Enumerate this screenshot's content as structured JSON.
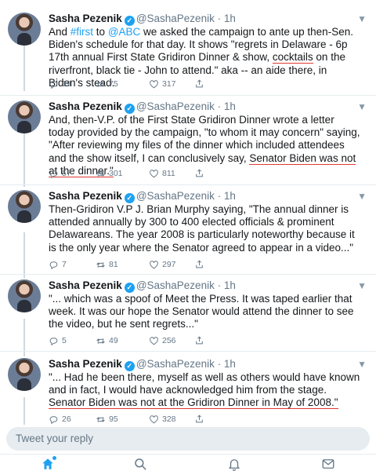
{
  "author": {
    "name": "Sasha Pezenik",
    "handle": "@SashaPezenik",
    "time": "· 1h"
  },
  "tweets": [
    {
      "t1": "And ",
      "t2": "#first",
      "t3": " to ",
      "t4": "@ABC",
      "t5": " we asked the campaign to ante up then-Sen. Biden's schedule for that day. It shows \"regrets in Delaware - 6p 17th annual First State Gridiron Dinner & show, ",
      "t6": "cocktails",
      "t7": " on the riverfront, black tie - John to attend.\" aka -- an aide there, in Biden's stead.",
      "reply_count": "19",
      "retweet_count": "75",
      "like_count": "317"
    },
    {
      "t1": "And, then-V.P. of the First State Gridiron Dinner wrote a letter today provided by the campaign, \"to whom it may concern\" saying, \"After reviewing my files of the dinner which included attendees and the show itself, I can conclusively say, ",
      "t2": "Senator Biden was not at the dinner.\"",
      "reply_count": "57",
      "retweet_count": "301",
      "like_count": "811"
    },
    {
      "t1": "Then-Gridiron V.P J. Brian Murphy saying, \"The annual dinner is attended annually by 300 to 400 elected officials & prominent Delawareans. The year 2008 is particularly noteworthy because it is the only year where the Senator agreed to appear in a video...\"",
      "reply_count": "7",
      "retweet_count": "81",
      "like_count": "297"
    },
    {
      "t1": "\"... which was a spoof of Meet the Press. It was taped earlier that week. It was our hope the Senator would attend the dinner to see the video, but he sent regrets...\"",
      "reply_count": "5",
      "retweet_count": "49",
      "like_count": "256"
    },
    {
      "t1": "\"... Had he been there, myself as well as others would have known and in fact, I would have acknowledged him from the stage. ",
      "t2": "Senator Biden was not at the Gridiron Dinner in May of 2008.\"",
      "reply_count": "26",
      "retweet_count": "95",
      "like_count": "328"
    }
  ],
  "reply_box": {
    "placeholder": "Tweet your reply"
  },
  "colors": {
    "accent": "#1da1f2",
    "highlight_underline": "#e03a2f"
  },
  "tabs": [
    "home-icon",
    "search-icon",
    "notifications-icon",
    "messages-icon"
  ]
}
